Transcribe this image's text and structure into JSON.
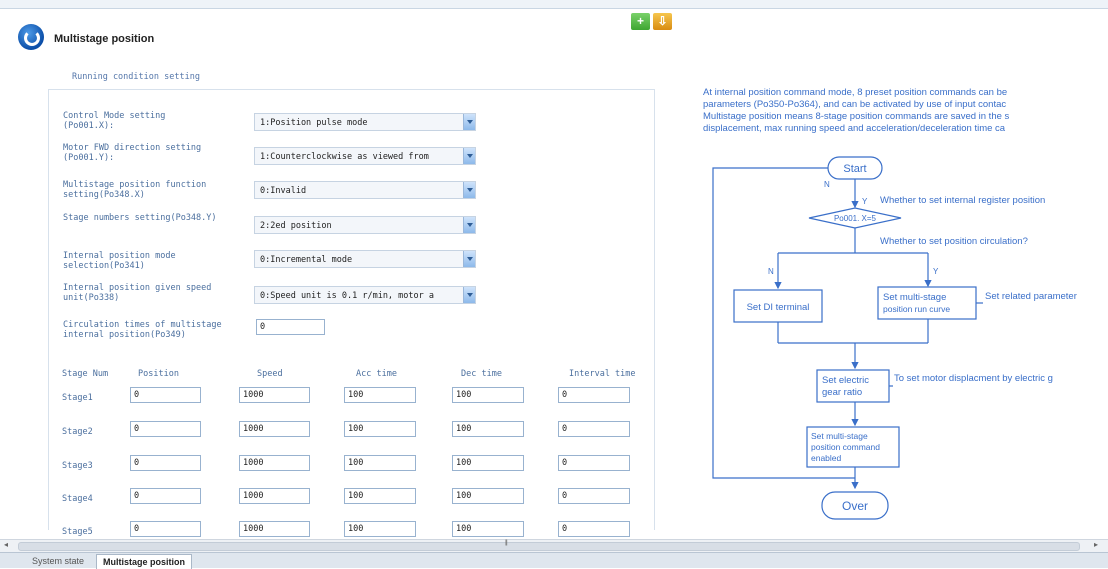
{
  "header": {
    "title": "Multistage position",
    "buttons": [
      {
        "icon": "plus-icon",
        "glyph": "+"
      },
      {
        "icon": "import-icon",
        "glyph": "⇩"
      }
    ]
  },
  "section_title": "Running condition setting",
  "settings": [
    {
      "label": "Control Mode setting\n(Po001.X):",
      "value": "1:Position pulse mode"
    },
    {
      "label": "Motor FWD direction setting\n(Po001.Y):",
      "value": "1:Counterclockwise as viewed from"
    },
    {
      "label": "Multistage position function\nsetting(Po348.X)",
      "value": "0:Invalid"
    },
    {
      "label": "Stage numbers setting(Po348.Y)",
      "value": "2:2ed position"
    },
    {
      "label": "Internal position mode\nselection(Po341)",
      "value": "0:Incremental mode"
    },
    {
      "label": "Internal position given speed\nunit(Po338)",
      "value": "0:Speed unit is 0.1 r/min, motor a"
    }
  ],
  "circulation": {
    "label": "Circulation times of multistage\ninternal position(Po349)",
    "value": "0"
  },
  "table": {
    "headers": [
      "Stage Num",
      "Position",
      "Speed",
      "Acc time",
      "Dec time",
      "Interval time"
    ],
    "rows": [
      {
        "stage": "Stage1",
        "position": "0",
        "speed": "1000",
        "acc": "100",
        "dec": "100",
        "interval": "0"
      },
      {
        "stage": "Stage2",
        "position": "0",
        "speed": "1000",
        "acc": "100",
        "dec": "100",
        "interval": "0"
      },
      {
        "stage": "Stage3",
        "position": "0",
        "speed": "1000",
        "acc": "100",
        "dec": "100",
        "interval": "0"
      },
      {
        "stage": "Stage4",
        "position": "0",
        "speed": "1000",
        "acc": "100",
        "dec": "100",
        "interval": "0"
      },
      {
        "stage": "Stage5",
        "position": "0",
        "speed": "1000",
        "acc": "100",
        "dec": "100",
        "interval": "0"
      }
    ]
  },
  "description": [
    "At internal position command mode, 8 preset position commands can be",
    "parameters (Po350-Po364), and can be activated by use of input contac",
    "Multistage position means 8-stage position commands are saved in the s",
    "displacement, max running speed and acceleration/deceleration time ca"
  ],
  "flowchart": {
    "start": "Start",
    "over": "Over",
    "decision": "Po001. X=5",
    "q1": "Whether to set internal register position",
    "q2": "Whether to set position circulation?",
    "n": "N",
    "y": "Y",
    "di_box": "Set DI terminal",
    "curve_box": [
      "Set multi-stage",
      "position run curve"
    ],
    "curve_note": "Set related parameter",
    "gear_box": [
      "Set electric",
      "gear ratio"
    ],
    "gear_note": "To set motor displacment by electric g",
    "enable_box": [
      "Set multi-stage",
      "position command",
      "enabled"
    ]
  },
  "tabs": [
    "System state",
    "Multistage position"
  ],
  "colors": {
    "accent": "#3a6fc9",
    "label": "#4b6f9e"
  }
}
